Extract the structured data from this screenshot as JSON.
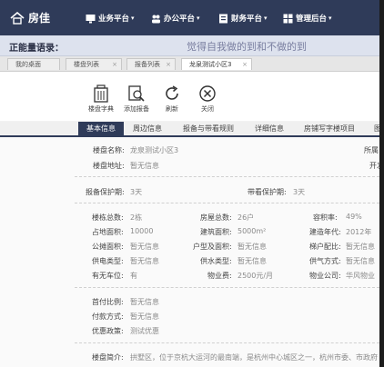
{
  "brand": {
    "name": "房佳"
  },
  "nav": [
    {
      "label": "业务平台"
    },
    {
      "label": "办公平台"
    },
    {
      "label": "财务平台"
    },
    {
      "label": "管理后台"
    }
  ],
  "motto": {
    "label": "正能量语录：",
    "text": "觉得自我做的到和不做的到"
  },
  "page_tabs": [
    {
      "label": "我的桌面"
    },
    {
      "label": "楼盘列表"
    },
    {
      "label": "报备列表"
    },
    {
      "label": "龙泉测试小区3"
    }
  ],
  "toolbar": {
    "dictionary": "楼盘字典",
    "add_report": "添加报备",
    "refresh": "刷新",
    "close": "关闭"
  },
  "info_tabs": [
    "基本信息",
    "周边信息",
    "报备与带看规则",
    "详细信息",
    "房铺写字楼项目",
    "图片"
  ],
  "basic": {
    "name_label": "楼盘名称:",
    "name_value": "龙泉测试小区3",
    "owner_label": "所属",
    "addr_label": "楼盘地址:",
    "addr_value": "暂无信息",
    "dev_label": "开发"
  },
  "protection": {
    "report_label": "报备保护期:",
    "report_value": "3天",
    "visit_label": "带看保护期:",
    "visit_value": "3天"
  },
  "stats": [
    {
      "l1": "楼栋总数:",
      "v1": "2栋",
      "l2": "房屋总数:",
      "v2": "26户",
      "l3": "容积率:",
      "v3": "49%"
    },
    {
      "l1": "占地面积:",
      "v1": "10000",
      "l2": "建筑面积:",
      "v2": "5000m²",
      "l3": "建造年代:",
      "v3": "2012年"
    },
    {
      "l1": "公摊面积:",
      "v1": "暂无信息",
      "l2": "户型及面积:",
      "v2": "暂无信息",
      "l3": "梯户配比:",
      "v3": "暂无信息"
    },
    {
      "l1": "供电类型:",
      "v1": "暂无信息",
      "l2": "供水类型:",
      "v2": "暂无信息",
      "l3": "供气方式:",
      "v3": "暂无信息"
    },
    {
      "l1": "有无车位:",
      "v1": "有",
      "l2": "物业费:",
      "v2": "2500元/月",
      "l3": "物业公司:",
      "v3": "华风物业"
    }
  ],
  "payment": [
    {
      "label": "首付比例:",
      "value": "暂无信息"
    },
    {
      "label": "付款方式:",
      "value": "暂无信息"
    },
    {
      "label": "优惠政策:",
      "value": "测试优惠"
    }
  ],
  "intro": {
    "label": "楼盘简介:",
    "value": "拱墅区，位于京杭大运河的最南端，是杭州中心城区之一，杭州市委、市政府"
  },
  "colors": {
    "header": "#2f3b59",
    "motto_bg": "#dde2ee",
    "active_tab": "#2f3b59"
  }
}
